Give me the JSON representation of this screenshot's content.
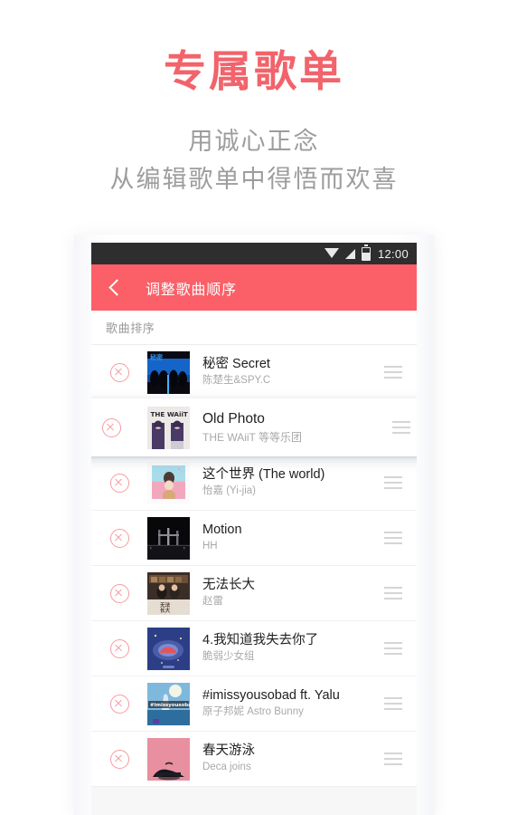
{
  "promo": {
    "title": "专属歌单",
    "subtitle_line1": "用诚心正念",
    "subtitle_line2": "从编辑歌单中得悟而欢喜",
    "title_color": "#f2636b",
    "subtitle_color": "#9d9d9d"
  },
  "statusbar": {
    "time": "12:00",
    "wifi_icon": "wifi-icon",
    "signal_icon": "signal-icon",
    "battery_icon": "battery-icon",
    "background": "#2e2e2e"
  },
  "appbar": {
    "back_icon": "back-chevron-icon",
    "title": "调整歌曲顺序",
    "background": "#fb5f67",
    "text_color": "#ffffff"
  },
  "section": {
    "label": "歌曲排序"
  },
  "list": {
    "delete_icon": "delete-circle-icon",
    "drag_icon": "drag-handle-icon",
    "songs": [
      {
        "title": "秘密 Secret",
        "artist": "陈楚生&SPY.C",
        "art": "album-secret",
        "dragging": false
      },
      {
        "title": "Old Photo",
        "artist": "THE WAiiT 等等乐团",
        "art": "album-old-photo",
        "dragging": true
      },
      {
        "title": "这个世界 (The world)",
        "artist": "怡嘉 (Yi-jia)",
        "art": "album-the-world",
        "dragging": false
      },
      {
        "title": "Motion",
        "artist": "HH",
        "art": "album-motion",
        "dragging": false
      },
      {
        "title": "无法长大",
        "artist": "赵雷",
        "art": "album-wufa",
        "dragging": false
      },
      {
        "title": "4.我知道我失去你了",
        "artist": "脆弱少女组",
        "art": "album-zhidao",
        "dragging": false
      },
      {
        "title": "#imissyousobad ft. Yalu",
        "artist": "原子邦妮 Astro Bunny",
        "art": "album-imissyousobad",
        "dragging": false
      },
      {
        "title": "春天游泳",
        "artist": "Deca joins",
        "art": "album-chuntian",
        "dragging": false
      }
    ]
  }
}
